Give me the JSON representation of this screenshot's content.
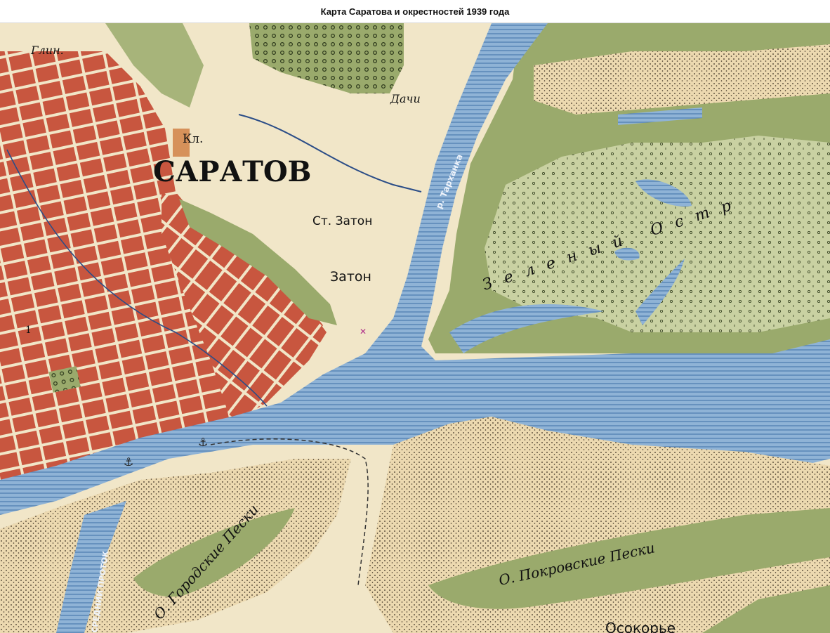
{
  "page": {
    "title": "Карта Саратова и окрестностей 1939 года"
  },
  "map": {
    "colors": {
      "paper": "#f1e6c8",
      "sand": "#ecd9b0",
      "city": "#c8563f",
      "city_dark": "#a8402c",
      "green": "#9aaa6c",
      "green_light": "#c9d1a2",
      "water": "#8fb3d6",
      "water_line": "#4f7fb2",
      "ink": "#222222"
    },
    "labels": {
      "city": "САРАТОВ",
      "glink": "Глин.",
      "kl": "Кл.",
      "dachi": "Дачи",
      "st_zaton": "Ст. Затон",
      "zaton": "Затон",
      "r_tarkhanka": "р. Тарханка",
      "zeleny_ostrov": "Зеленый Остр",
      "gorodskie_peski": "О. Городские Пески",
      "pokrovskie_peski": "О. Покровские Пески",
      "sredniy_protok": "СРЕДНИЙ ПРОТОК",
      "osokorye": "Осокорье",
      "block_number": "1"
    }
  }
}
